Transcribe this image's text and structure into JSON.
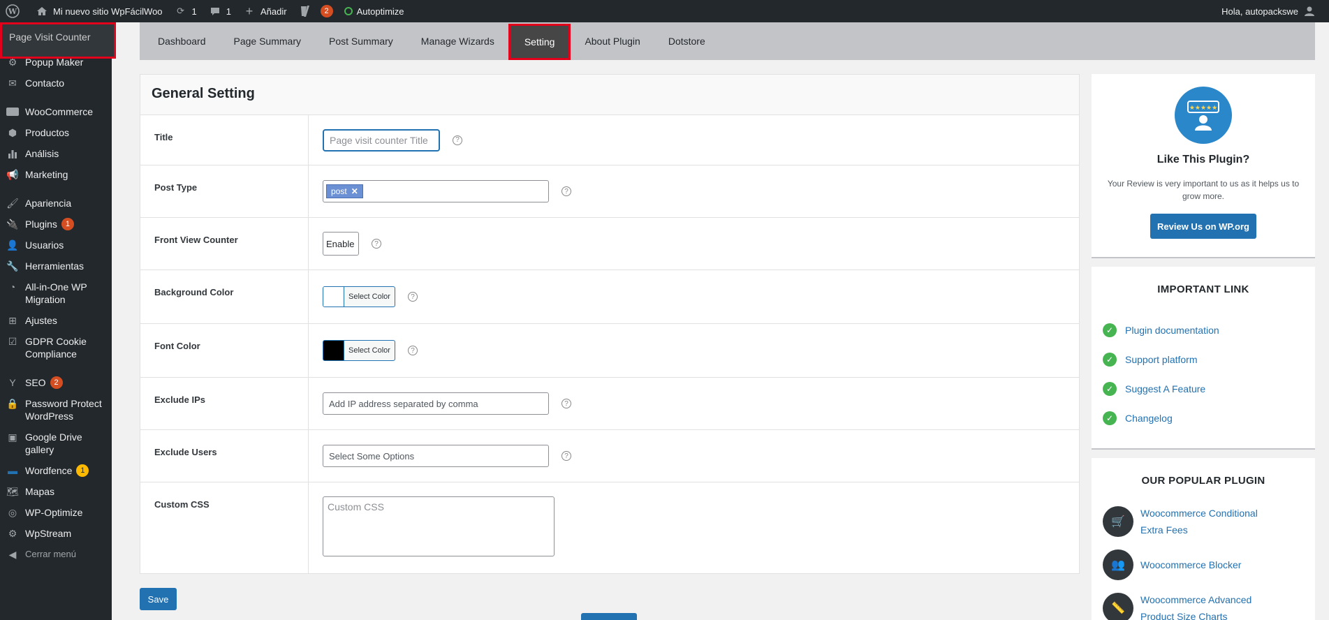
{
  "adminbar": {
    "site_name": "Mi nuevo sitio WpFácilWoo",
    "updates_count": "1",
    "comments_count": "1",
    "add_new": "Añadir",
    "yoast_badge": "2",
    "autoptimize": "Autoptimize",
    "greeting": "Hola, autopackswe"
  },
  "sidebar": {
    "current": "Page Visit Counter",
    "items": [
      {
        "label": "Popup Maker"
      },
      {
        "label": "Contacto"
      },
      {
        "label": "WooCommerce"
      },
      {
        "label": "Productos"
      },
      {
        "label": "Análisis"
      },
      {
        "label": "Marketing"
      },
      {
        "label": "Apariencia"
      },
      {
        "label": "Plugins",
        "badge": "1"
      },
      {
        "label": "Usuarios"
      },
      {
        "label": "Herramientas"
      },
      {
        "label": "All-in-One WP Migration"
      },
      {
        "label": "Ajustes"
      },
      {
        "label": "GDPR Cookie Compliance"
      },
      {
        "label": "SEO",
        "badge": "2"
      },
      {
        "label": "Password Protect WordPress"
      },
      {
        "label": "Google Drive gallery"
      },
      {
        "label": "Wordfence",
        "badge": "1"
      },
      {
        "label": "Mapas"
      },
      {
        "label": "WP-Optimize"
      },
      {
        "label": "WpStream"
      }
    ],
    "collapse": "Cerrar menú"
  },
  "tabs": [
    "Dashboard",
    "Page Summary",
    "Post Summary",
    "Manage Wizards",
    "Setting",
    "About Plugin",
    "Dotstore"
  ],
  "active_tab": "Setting",
  "settings": {
    "heading": "General Setting",
    "title_label": "Title",
    "title_placeholder": "Page visit counter Title",
    "post_type_label": "Post Type",
    "post_type_chip": "post",
    "front_view_label": "Front View Counter",
    "front_view_value": "Enable",
    "bg_color_label": "Background Color",
    "bg_color_button": "Select Color",
    "bg_color_value": "#ffffff",
    "font_color_label": "Font Color",
    "font_color_button": "Select Color",
    "font_color_value": "#000000",
    "exclude_ips_label": "Exclude IPs",
    "exclude_ips_placeholder": "Add IP address separated by comma",
    "exclude_users_label": "Exclude Users",
    "exclude_users_placeholder": "Select Some Options",
    "custom_css_label": "Custom CSS",
    "custom_css_placeholder": "Custom CSS",
    "save_label": "Save"
  },
  "like_card": {
    "title": "Like This Plugin?",
    "text": "Your Review is very important to us as it helps us to grow more.",
    "button": "Review Us on WP.org"
  },
  "links_card": {
    "title": "IMPORTANT LINK",
    "links": [
      "Plugin documentation",
      "Support platform",
      "Suggest A Feature",
      "Changelog"
    ]
  },
  "popular_card": {
    "title": "OUR POPULAR PLUGIN",
    "plugins": [
      "Woocommerce Conditional Extra Fees",
      "Woocommerce Blocker",
      "Woocommerce Advanced Product Size Charts"
    ]
  },
  "colors": {
    "accent": "#2271b1",
    "highlight": "#e3001b",
    "sidebar": "#23282d"
  }
}
